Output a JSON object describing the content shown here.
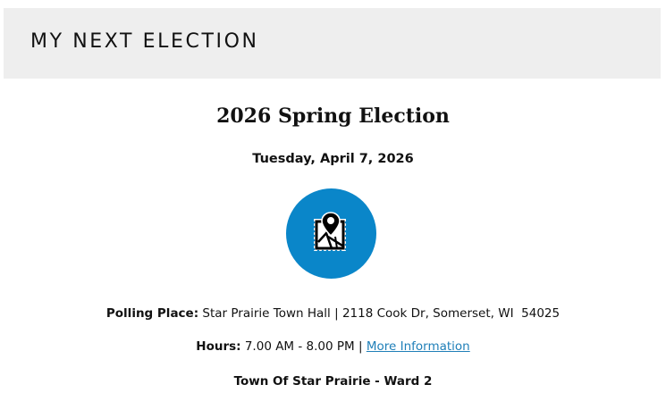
{
  "header": {
    "title": "MY NEXT ELECTION"
  },
  "election": {
    "name": "2026 Spring Election",
    "date": "Tuesday, April 7, 2026",
    "icon": "map-pin-icon",
    "icon_color": "#0a86c9"
  },
  "polling": {
    "label": "Polling Place:",
    "location": "Star Prairie Town Hall",
    "separator": "|",
    "address": "2118 Cook Dr, Somerset, WI  54025"
  },
  "hours": {
    "label": "Hours:",
    "value": "7.00 AM - 8.00 PM",
    "separator": "|",
    "link_text": "More Information",
    "link_color": "#1f7fb8"
  },
  "ward": {
    "text": "Town Of Star Prairie - Ward 2"
  }
}
